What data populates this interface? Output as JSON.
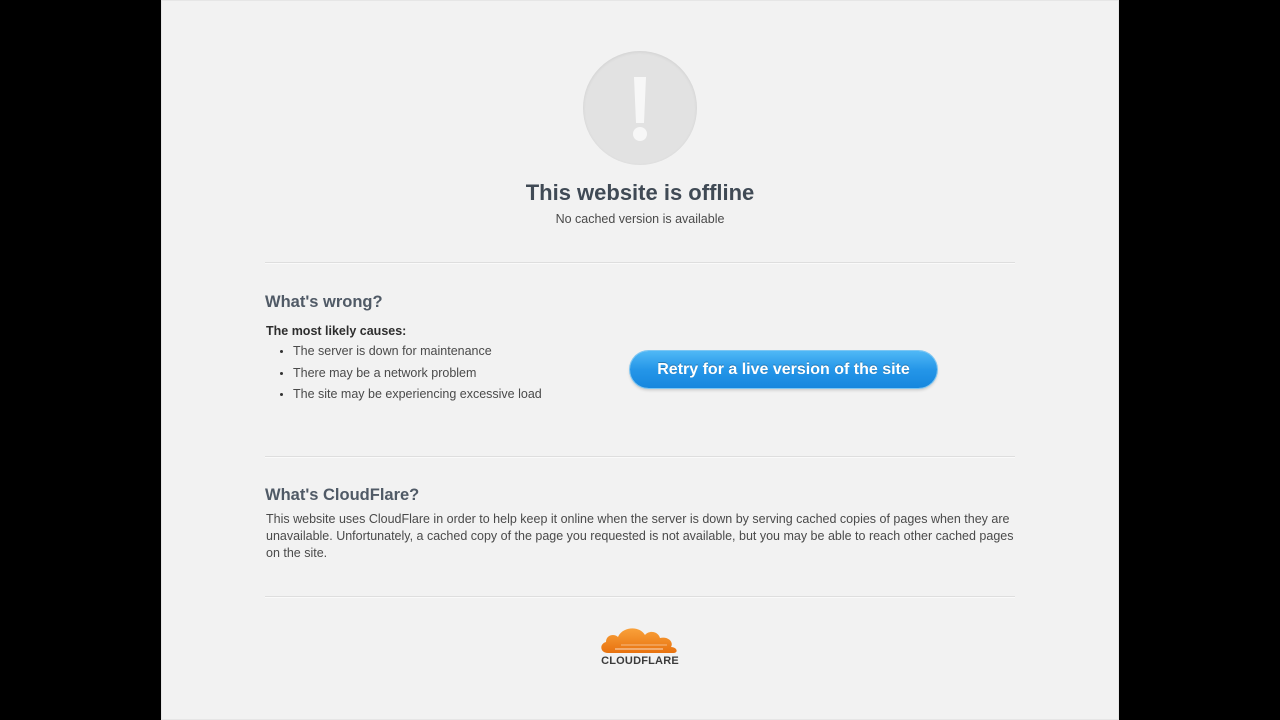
{
  "page": {
    "background": "#f2f2f2",
    "frame_background": "#000000"
  },
  "status": {
    "icon": "exclamation-icon",
    "title": "This website is offline",
    "subtitle": "No cached version is available"
  },
  "whats_wrong": {
    "heading": "What's wrong?",
    "causes_heading": "The most likely causes:",
    "causes": [
      "The server is down for maintenance",
      "There may be a network problem",
      "The site may be experiencing excessive load"
    ]
  },
  "retry": {
    "label": "Retry for a live version of the site",
    "color": "#2596e8"
  },
  "whats_cloudflare": {
    "heading": "What's CloudFlare?",
    "text": "This website uses CloudFlare in order to help keep it online when the server is down by serving cached copies of pages when they are unavailable. Unfortunately, a cached copy of the page you requested is not available, but you may be able to reach other cached pages on the site."
  },
  "footer": {
    "logo_icon": "cloudflare-cloud-icon",
    "logo_text": "CLOUDFLARE",
    "logo_color": "#f38020"
  }
}
